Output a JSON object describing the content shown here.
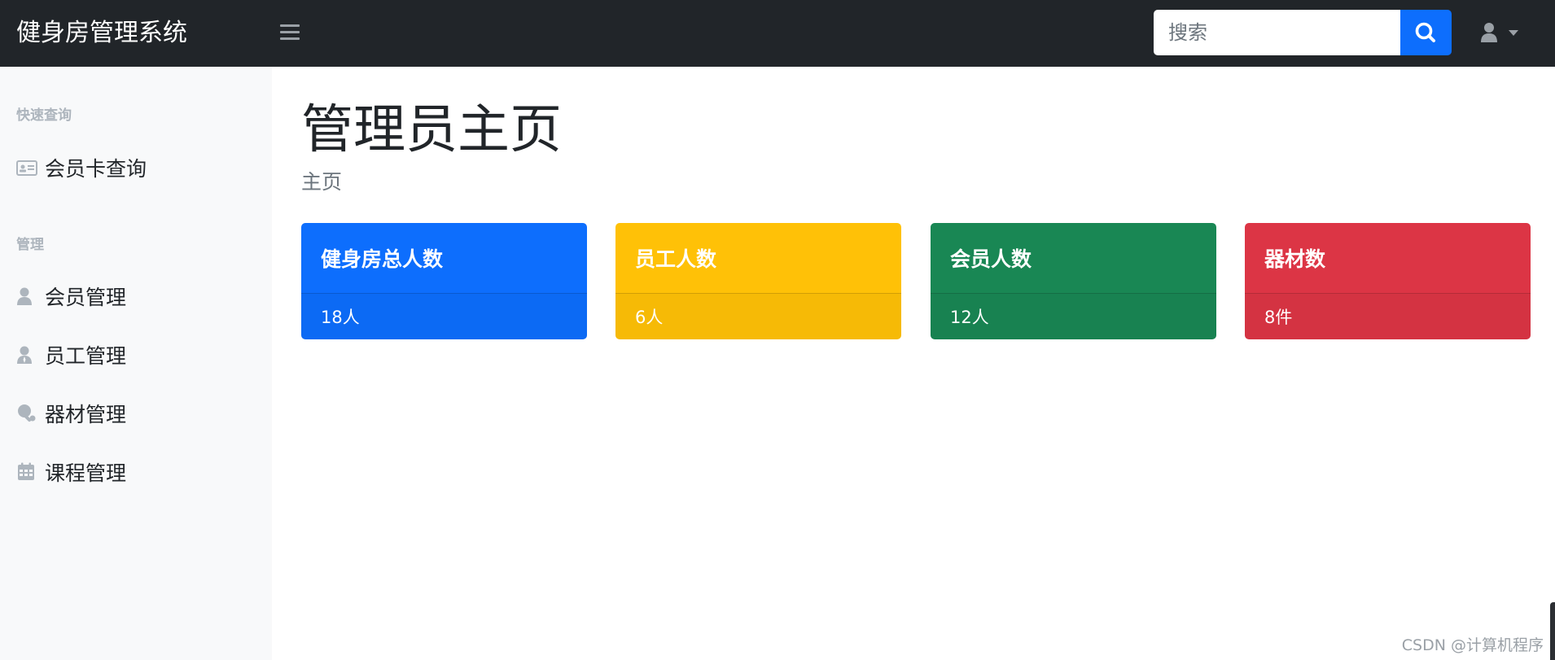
{
  "header": {
    "brand": "健身房管理系统",
    "search_placeholder": "搜索"
  },
  "sidebar": {
    "sections": [
      {
        "heading": "快速查询",
        "items": [
          {
            "label": "会员卡查询",
            "icon": "id-card-icon"
          }
        ]
      },
      {
        "heading": "管理",
        "items": [
          {
            "label": "会员管理",
            "icon": "user-icon"
          },
          {
            "label": "员工管理",
            "icon": "user-tie-icon"
          },
          {
            "label": "器材管理",
            "icon": "table-tennis-icon"
          },
          {
            "label": "课程管理",
            "icon": "calendar-icon"
          }
        ]
      }
    ]
  },
  "main": {
    "title": "管理员主页",
    "breadcrumb": "主页",
    "cards": [
      {
        "title": "健身房总人数",
        "value": "18人",
        "color": "#0d6efd"
      },
      {
        "title": "员工人数",
        "value": "6人",
        "color": "#ffc107"
      },
      {
        "title": "会员人数",
        "value": "12人",
        "color": "#198754"
      },
      {
        "title": "器材数",
        "value": "8件",
        "color": "#dc3545"
      }
    ]
  },
  "watermark": "CSDN @计算机程序"
}
